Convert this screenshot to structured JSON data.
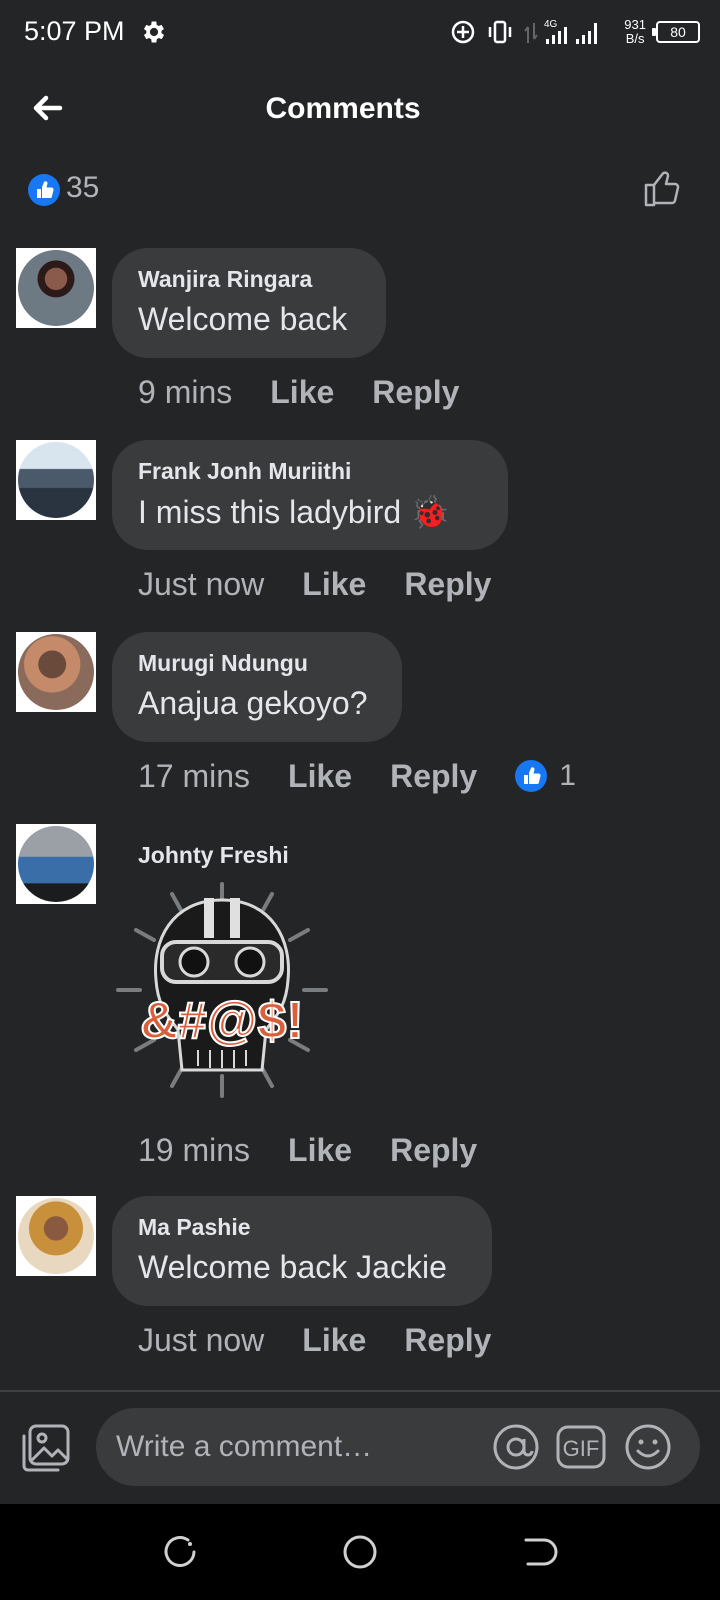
{
  "status_bar": {
    "time": "5:07 PM",
    "net_speed_value": "931",
    "net_speed_unit": "B/s",
    "network": "4G",
    "battery": "80"
  },
  "header": {
    "title": "Comments"
  },
  "reactions": {
    "count": "35"
  },
  "comments": [
    {
      "author": "Wanjira Ringara",
      "text": "Welcome back",
      "time": "9 mins",
      "like": "Like",
      "reply": "Reply"
    },
    {
      "author": "Frank Jonh Muriithi",
      "text": "I miss this ladybird 🐞",
      "time": "Just now",
      "like": "Like",
      "reply": "Reply"
    },
    {
      "author": "Murugi Ndungu",
      "text": "Anajua gekoyo?",
      "time": "17 mins",
      "like": "Like",
      "reply": "Reply",
      "reaction_count": "1"
    },
    {
      "author": "Johnty Freshi",
      "sticker_text": "&#@$!",
      "time": "19 mins",
      "like": "Like",
      "reply": "Reply"
    },
    {
      "author": "Ma Pashie",
      "text": "Welcome back Jackie",
      "time": "Just now",
      "like": "Like",
      "reply": "Reply"
    }
  ],
  "composer": {
    "placeholder": "Write a comment…",
    "gif_label": "GIF"
  },
  "colors": {
    "background": "#242526",
    "bubble": "#3a3b3c",
    "accent": "#1877f2",
    "meta_text": "#b0b3b8",
    "text": "#e4e6eb"
  },
  "icons": [
    "gear-icon",
    "location-icon",
    "vibrate-icon",
    "signal-icon",
    "battery-icon",
    "back-arrow-icon",
    "like-icon",
    "thumbs-up-outline-icon",
    "photo-icon",
    "mention-icon",
    "gif-icon",
    "emoji-icon",
    "recent-apps-icon",
    "home-icon",
    "back-nav-icon"
  ]
}
